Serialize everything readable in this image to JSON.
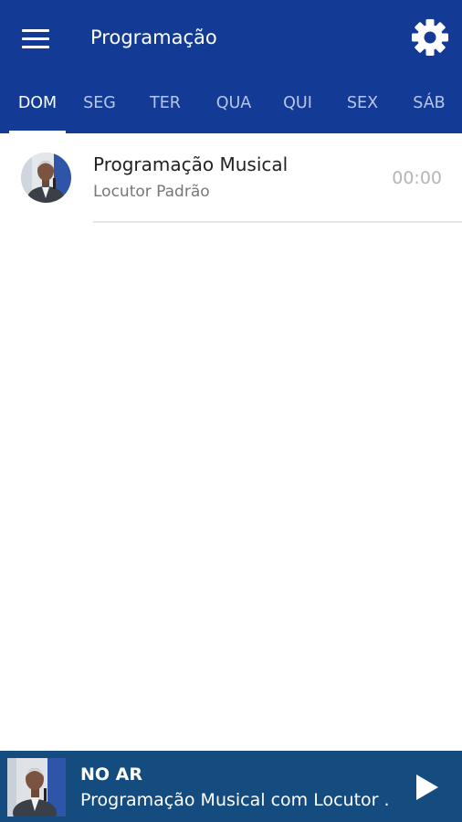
{
  "header": {
    "title": "Programação",
    "menu_icon": "hamburger-menu-icon",
    "settings_icon": "gear-icon",
    "background": "#133a94"
  },
  "tabs": [
    {
      "label": "DOM",
      "active": true
    },
    {
      "label": "SEG",
      "active": false
    },
    {
      "label": "TER",
      "active": false
    },
    {
      "label": "QUA",
      "active": false
    },
    {
      "label": "QUI",
      "active": false
    },
    {
      "label": "SEX",
      "active": false
    },
    {
      "label": "SÁB",
      "active": false
    }
  ],
  "schedule": [
    {
      "title": "Programação Musical",
      "host": "Locutor Padrão",
      "time": "00:00"
    }
  ],
  "player": {
    "status": "NO AR",
    "now_playing": "Programação Musical com Locutor ...",
    "play_icon": "play-icon",
    "background": "#154c7f"
  }
}
